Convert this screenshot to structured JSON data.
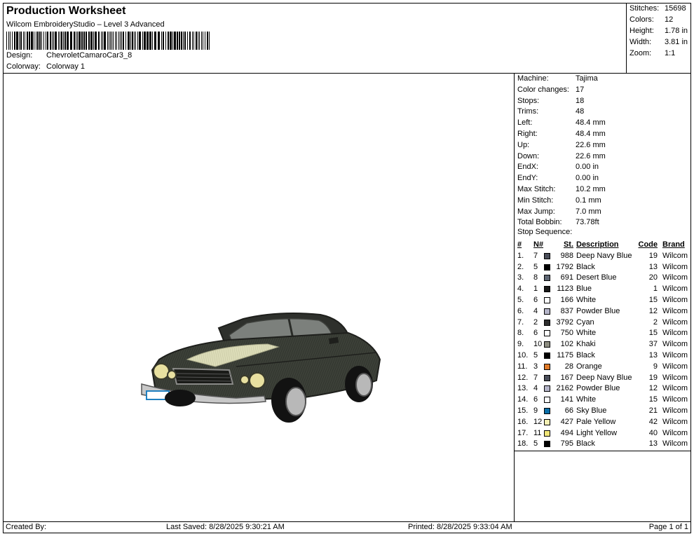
{
  "header": {
    "title": "Production Worksheet",
    "subtitle": "Wilcom EmbroideryStudio – Level 3 Advanced",
    "design_label": "Design:",
    "design_value": "ChevroletCamaroCar3_8",
    "colorway_label": "Colorway:",
    "colorway_value": "Colorway 1"
  },
  "summary": [
    {
      "label": "Stitches:",
      "value": "15698"
    },
    {
      "label": "Colors:",
      "value": "12"
    },
    {
      "label": "Height:",
      "value": "1.78 in"
    },
    {
      "label": "Width:",
      "value": "3.81 in"
    },
    {
      "label": "Zoom:",
      "value": "1:1"
    }
  ],
  "stats": [
    {
      "label": "Machine:",
      "value": "Tajima"
    },
    {
      "label": "Color changes:",
      "value": "17"
    },
    {
      "label": "Stops:",
      "value": "18"
    },
    {
      "label": "Trims:",
      "value": "48"
    },
    {
      "label": "Left:",
      "value": "48.4 mm"
    },
    {
      "label": "Right:",
      "value": "48.4 mm"
    },
    {
      "label": "Up:",
      "value": "22.6 mm"
    },
    {
      "label": "Down:",
      "value": "22.6 mm"
    },
    {
      "label": "EndX:",
      "value": "0.00 in"
    },
    {
      "label": "EndY:",
      "value": "0.00 in"
    },
    {
      "label": "Max Stitch:",
      "value": "10.2 mm"
    },
    {
      "label": "Min Stitch:",
      "value": "0.1 mm"
    },
    {
      "label": "Max Jump:",
      "value": "7.0 mm"
    },
    {
      "label": "Total Bobbin:",
      "value": "73.78ft"
    }
  ],
  "sequence": {
    "title": "Stop Sequence:",
    "columns": {
      "num": "#",
      "n": "N#",
      "st": "St.",
      "desc": "Description",
      "code": "Code",
      "brand": "Brand"
    },
    "rows": [
      {
        "num": "1.",
        "n": "7",
        "color": "#4a4e5a",
        "st": "988",
        "desc": "Deep Navy Blue",
        "code": "19",
        "brand": "Wilcom"
      },
      {
        "num": "2.",
        "n": "5",
        "color": "#000000",
        "st": "1792",
        "desc": "Black",
        "code": "13",
        "brand": "Wilcom"
      },
      {
        "num": "3.",
        "n": "8",
        "color": "#5e6673",
        "st": "691",
        "desc": "Desert Blue",
        "code": "20",
        "brand": "Wilcom"
      },
      {
        "num": "4.",
        "n": "1",
        "color": "#1a1a1a",
        "st": "1123",
        "desc": "Blue",
        "code": "1",
        "brand": "Wilcom"
      },
      {
        "num": "5.",
        "n": "6",
        "color": "#ffffff",
        "st": "166",
        "desc": "White",
        "code": "15",
        "brand": "Wilcom"
      },
      {
        "num": "6.",
        "n": "4",
        "color": "#b4b4c8",
        "st": "837",
        "desc": "Powder Blue",
        "code": "12",
        "brand": "Wilcom"
      },
      {
        "num": "7.",
        "n": "2",
        "color": "#2e2e2e",
        "st": "3792",
        "desc": "Cyan",
        "code": "2",
        "brand": "Wilcom"
      },
      {
        "num": "8.",
        "n": "6",
        "color": "#ffffff",
        "st": "750",
        "desc": "White",
        "code": "15",
        "brand": "Wilcom"
      },
      {
        "num": "9.",
        "n": "10",
        "color": "#8c8c80",
        "st": "102",
        "desc": "Khaki",
        "code": "37",
        "brand": "Wilcom"
      },
      {
        "num": "10.",
        "n": "5",
        "color": "#000000",
        "st": "1175",
        "desc": "Black",
        "code": "13",
        "brand": "Wilcom"
      },
      {
        "num": "11.",
        "n": "3",
        "color": "#e07a28",
        "st": "28",
        "desc": "Orange",
        "code": "9",
        "brand": "Wilcom"
      },
      {
        "num": "12.",
        "n": "7",
        "color": "#4a4e5a",
        "st": "167",
        "desc": "Deep Navy Blue",
        "code": "19",
        "brand": "Wilcom"
      },
      {
        "num": "13.",
        "n": "4",
        "color": "#b4b4c8",
        "st": "2162",
        "desc": "Powder Blue",
        "code": "12",
        "brand": "Wilcom"
      },
      {
        "num": "14.",
        "n": "6",
        "color": "#ffffff",
        "st": "141",
        "desc": "White",
        "code": "15",
        "brand": "Wilcom"
      },
      {
        "num": "15.",
        "n": "9",
        "color": "#0a6ea8",
        "st": "66",
        "desc": "Sky Blue",
        "code": "21",
        "brand": "Wilcom"
      },
      {
        "num": "16.",
        "n": "12",
        "color": "#f4f0b4",
        "st": "427",
        "desc": "Pale Yellow",
        "code": "42",
        "brand": "Wilcom"
      },
      {
        "num": "17.",
        "n": "11",
        "color": "#f0e678",
        "st": "494",
        "desc": "Light Yellow",
        "code": "40",
        "brand": "Wilcom"
      },
      {
        "num": "18.",
        "n": "5",
        "color": "#000000",
        "st": "795",
        "desc": "Black",
        "code": "13",
        "brand": "Wilcom"
      }
    ]
  },
  "footer": {
    "created": "Created By:",
    "saved": "Last Saved: 8/28/2025 9:30:21 AM",
    "printed": "Printed: 8/28/2025 9:33:04 AM",
    "page": "Page 1 of 1"
  },
  "colors": {
    "car_body": "#3c4038",
    "car_stripe": "#d8d8b0",
    "headlight": "#e8e0a0"
  },
  "icons": {
    "barcode": "barcode-graphic",
    "design": "embroidery-car-preview"
  }
}
